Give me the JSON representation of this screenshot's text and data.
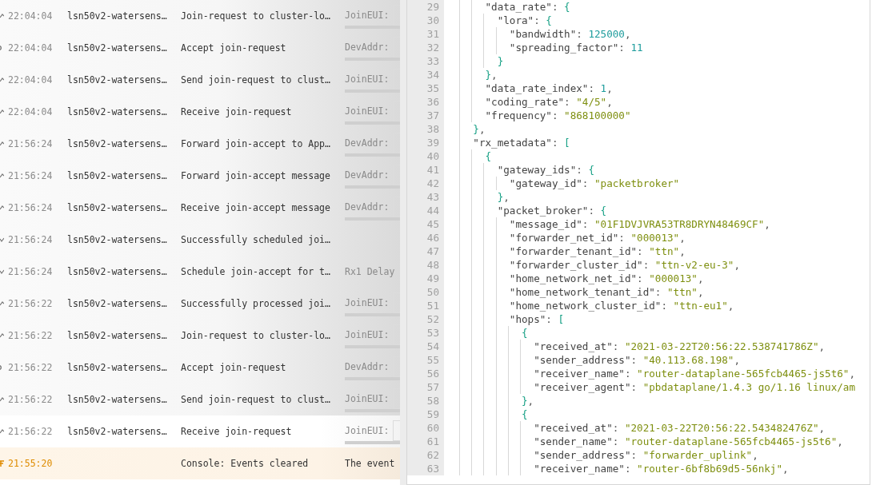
{
  "events": [
    {
      "kind": "up",
      "time": "22:04:04",
      "device": "lsn50v2-watersens…",
      "message": "Join-request to cluster-lo…",
      "preview": {
        "label": "JoinEUI:",
        "kind": "chip"
      },
      "selected": false
    },
    {
      "kind": "accept",
      "time": "22:04:04",
      "device": "lsn50v2-watersens…",
      "message": "Accept join-request",
      "preview": {
        "label": "DevAddr:",
        "kind": "chip"
      },
      "selected": false
    },
    {
      "kind": "up",
      "time": "22:04:04",
      "device": "lsn50v2-watersens…",
      "message": "Send join-request to clust…",
      "preview": {
        "label": "JoinEUI:",
        "kind": "chip"
      },
      "selected": false
    },
    {
      "kind": "up",
      "time": "22:04:04",
      "device": "lsn50v2-watersens…",
      "message": "Receive join-request",
      "preview": {
        "label": "JoinEUI:",
        "kind": "chip"
      },
      "selected": false
    },
    {
      "kind": "up",
      "time": "21:56:24",
      "device": "lsn50v2-watersens…",
      "message": "Forward join-accept to App…",
      "preview": {
        "label": "DevAddr:",
        "kind": "chip"
      },
      "selected": false
    },
    {
      "kind": "up",
      "time": "21:56:24",
      "device": "lsn50v2-watersens…",
      "message": "Forward join-accept message",
      "preview": {
        "label": "DevAddr:",
        "kind": "chip"
      },
      "selected": false
    },
    {
      "kind": "up",
      "time": "21:56:24",
      "device": "lsn50v2-watersens…",
      "message": "Receive join-accept message",
      "preview": {
        "label": "DevAddr:",
        "kind": "chip"
      },
      "selected": false
    },
    {
      "kind": "down",
      "time": "21:56:24",
      "device": "lsn50v2-watersens…",
      "message": "Successfully scheduled joi…",
      "selected": false
    },
    {
      "kind": "down",
      "time": "21:56:24",
      "device": "lsn50v2-watersens…",
      "message": "Schedule join-accept for t…",
      "preview": {
        "label": "Rx1 Delay",
        "kind": "text"
      },
      "selected": false
    },
    {
      "kind": "up",
      "time": "21:56:22",
      "device": "lsn50v2-watersens…",
      "message": "Successfully processed joi…",
      "preview": {
        "label": "JoinEUI:",
        "kind": "chip"
      },
      "selected": false
    },
    {
      "kind": "up",
      "time": "21:56:22",
      "device": "lsn50v2-watersens…",
      "message": "Join-request to cluster-lo…",
      "preview": {
        "label": "JoinEUI:",
        "kind": "chip"
      },
      "selected": false
    },
    {
      "kind": "accept",
      "time": "21:56:22",
      "device": "lsn50v2-watersens…",
      "message": "Accept join-request",
      "preview": {
        "label": "DevAddr:",
        "kind": "chip"
      },
      "selected": false
    },
    {
      "kind": "up",
      "time": "21:56:22",
      "device": "lsn50v2-watersens…",
      "message": "Send join-request to clust…",
      "preview": {
        "label": "JoinEUI:",
        "kind": "chip"
      },
      "selected": false
    },
    {
      "kind": "up",
      "time": "21:56:22",
      "device": "lsn50v2-watersens…",
      "message": "Receive join-request",
      "preview": {
        "label": "JoinEUI:",
        "kind": "chip"
      },
      "selected": true
    },
    {
      "kind": "console",
      "time": "21:55:20",
      "message": "Console: Events cleared",
      "preview": {
        "label": "The event",
        "kind": "text"
      },
      "selected": false
    }
  ],
  "code_lines": [
    {
      "n": "29",
      "t": [
        {
          "text": "      \"data_rate\"",
          "kind": "key"
        },
        {
          "text": ": ",
          "kind": "punct"
        },
        {
          "text": "{",
          "kind": "bracket"
        }
      ]
    },
    {
      "n": "30",
      "t": [
        {
          "text": "        \"lora\"",
          "kind": "key"
        },
        {
          "text": ": ",
          "kind": "punct"
        },
        {
          "text": "{",
          "kind": "bracket"
        }
      ]
    },
    {
      "n": "31",
      "t": [
        {
          "text": "          \"bandwidth\"",
          "kind": "key"
        },
        {
          "text": ": ",
          "kind": "punct"
        },
        {
          "text": "125000",
          "kind": "number"
        },
        {
          "text": ",",
          "kind": "punct"
        }
      ]
    },
    {
      "n": "32",
      "t": [
        {
          "text": "          \"spreading_factor\"",
          "kind": "key"
        },
        {
          "text": ": ",
          "kind": "punct"
        },
        {
          "text": "11",
          "kind": "number"
        }
      ]
    },
    {
      "n": "33",
      "t": [
        {
          "text": "        }",
          "kind": "bracket"
        }
      ]
    },
    {
      "n": "34",
      "t": [
        {
          "text": "      }",
          "kind": "bracket"
        },
        {
          "text": ",",
          "kind": "punct"
        }
      ]
    },
    {
      "n": "35",
      "t": [
        {
          "text": "      \"data_rate_index\"",
          "kind": "key"
        },
        {
          "text": ": ",
          "kind": "punct"
        },
        {
          "text": "1",
          "kind": "number"
        },
        {
          "text": ",",
          "kind": "punct"
        }
      ]
    },
    {
      "n": "36",
      "t": [
        {
          "text": "      \"coding_rate\"",
          "kind": "key"
        },
        {
          "text": ": ",
          "kind": "punct"
        },
        {
          "text": "\"4/5\"",
          "kind": "string"
        },
        {
          "text": ",",
          "kind": "punct"
        }
      ]
    },
    {
      "n": "37",
      "t": [
        {
          "text": "      \"frequency\"",
          "kind": "key"
        },
        {
          "text": ": ",
          "kind": "punct"
        },
        {
          "text": "\"868100000\"",
          "kind": "string"
        }
      ]
    },
    {
      "n": "38",
      "t": [
        {
          "text": "    }",
          "kind": "bracket"
        },
        {
          "text": ",",
          "kind": "punct"
        }
      ]
    },
    {
      "n": "39",
      "t": [
        {
          "text": "    \"rx_metadata\"",
          "kind": "key"
        },
        {
          "text": ": ",
          "kind": "punct"
        },
        {
          "text": "[",
          "kind": "bracket"
        }
      ]
    },
    {
      "n": "40",
      "t": [
        {
          "text": "      {",
          "kind": "bracket"
        }
      ]
    },
    {
      "n": "41",
      "t": [
        {
          "text": "        \"gateway_ids\"",
          "kind": "key"
        },
        {
          "text": ": ",
          "kind": "punct"
        },
        {
          "text": "{",
          "kind": "bracket"
        }
      ]
    },
    {
      "n": "42",
      "t": [
        {
          "text": "          \"gateway_id\"",
          "kind": "key"
        },
        {
          "text": ": ",
          "kind": "punct"
        },
        {
          "text": "\"packetbroker\"",
          "kind": "string"
        }
      ]
    },
    {
      "n": "43",
      "t": [
        {
          "text": "        }",
          "kind": "bracket"
        },
        {
          "text": ",",
          "kind": "punct"
        }
      ]
    },
    {
      "n": "44",
      "t": [
        {
          "text": "        \"packet_broker\"",
          "kind": "key"
        },
        {
          "text": ": ",
          "kind": "punct"
        },
        {
          "text": "{",
          "kind": "bracket"
        }
      ]
    },
    {
      "n": "45",
      "t": [
        {
          "text": "          \"message_id\"",
          "kind": "key"
        },
        {
          "text": ": ",
          "kind": "punct"
        },
        {
          "text": "\"01F1DVJVRA53TR8DRYN48469CF\"",
          "kind": "string"
        },
        {
          "text": ",",
          "kind": "punct"
        }
      ]
    },
    {
      "n": "46",
      "t": [
        {
          "text": "          \"forwarder_net_id\"",
          "kind": "key"
        },
        {
          "text": ": ",
          "kind": "punct"
        },
        {
          "text": "\"000013\"",
          "kind": "string"
        },
        {
          "text": ",",
          "kind": "punct"
        }
      ]
    },
    {
      "n": "47",
      "t": [
        {
          "text": "          \"forwarder_tenant_id\"",
          "kind": "key"
        },
        {
          "text": ": ",
          "kind": "punct"
        },
        {
          "text": "\"ttn\"",
          "kind": "string"
        },
        {
          "text": ",",
          "kind": "punct"
        }
      ]
    },
    {
      "n": "48",
      "t": [
        {
          "text": "          \"forwarder_cluster_id\"",
          "kind": "key"
        },
        {
          "text": ": ",
          "kind": "punct"
        },
        {
          "text": "\"ttn-v2-eu-3\"",
          "kind": "string"
        },
        {
          "text": ",",
          "kind": "punct"
        }
      ]
    },
    {
      "n": "49",
      "t": [
        {
          "text": "          \"home_network_net_id\"",
          "kind": "key"
        },
        {
          "text": ": ",
          "kind": "punct"
        },
        {
          "text": "\"000013\"",
          "kind": "string"
        },
        {
          "text": ",",
          "kind": "punct"
        }
      ]
    },
    {
      "n": "50",
      "t": [
        {
          "text": "          \"home_network_tenant_id\"",
          "kind": "key"
        },
        {
          "text": ": ",
          "kind": "punct"
        },
        {
          "text": "\"ttn\"",
          "kind": "string"
        },
        {
          "text": ",",
          "kind": "punct"
        }
      ]
    },
    {
      "n": "51",
      "t": [
        {
          "text": "          \"home_network_cluster_id\"",
          "kind": "key"
        },
        {
          "text": ": ",
          "kind": "punct"
        },
        {
          "text": "\"ttn-eu1\"",
          "kind": "string"
        },
        {
          "text": ",",
          "kind": "punct"
        }
      ]
    },
    {
      "n": "52",
      "t": [
        {
          "text": "          \"hops\"",
          "kind": "key"
        },
        {
          "text": ": ",
          "kind": "punct"
        },
        {
          "text": "[",
          "kind": "bracket"
        }
      ]
    },
    {
      "n": "53",
      "t": [
        {
          "text": "            {",
          "kind": "bracket"
        }
      ]
    },
    {
      "n": "54",
      "t": [
        {
          "text": "              \"received_at\"",
          "kind": "key"
        },
        {
          "text": ": ",
          "kind": "punct"
        },
        {
          "text": "\"2021-03-22T20:56:22.538741786Z\"",
          "kind": "string"
        },
        {
          "text": ",",
          "kind": "punct"
        }
      ]
    },
    {
      "n": "55",
      "t": [
        {
          "text": "              \"sender_address\"",
          "kind": "key"
        },
        {
          "text": ": ",
          "kind": "punct"
        },
        {
          "text": "\"40.113.68.198\"",
          "kind": "string"
        },
        {
          "text": ",",
          "kind": "punct"
        }
      ]
    },
    {
      "n": "56",
      "t": [
        {
          "text": "              \"receiver_name\"",
          "kind": "key"
        },
        {
          "text": ": ",
          "kind": "punct"
        },
        {
          "text": "\"router-dataplane-565fcb4465-js5t6\"",
          "kind": "string"
        },
        {
          "text": ",",
          "kind": "punct"
        }
      ]
    },
    {
      "n": "57",
      "t": [
        {
          "text": "              \"receiver_agent\"",
          "kind": "key"
        },
        {
          "text": ": ",
          "kind": "punct"
        },
        {
          "text": "\"pbdataplane/1.4.3 go/1.16 linux/am",
          "kind": "string"
        }
      ]
    },
    {
      "n": "58",
      "t": [
        {
          "text": "            }",
          "kind": "bracket"
        },
        {
          "text": ",",
          "kind": "punct"
        }
      ]
    },
    {
      "n": "59",
      "t": [
        {
          "text": "            {",
          "kind": "bracket"
        }
      ]
    },
    {
      "n": "60",
      "t": [
        {
          "text": "              \"received_at\"",
          "kind": "key"
        },
        {
          "text": ": ",
          "kind": "punct"
        },
        {
          "text": "\"2021-03-22T20:56:22.543482476Z\"",
          "kind": "string"
        },
        {
          "text": ",",
          "kind": "punct"
        }
      ]
    },
    {
      "n": "61",
      "t": [
        {
          "text": "              \"sender_name\"",
          "kind": "key"
        },
        {
          "text": ": ",
          "kind": "punct"
        },
        {
          "text": "\"router-dataplane-565fcb4465-js5t6\"",
          "kind": "string"
        },
        {
          "text": ",",
          "kind": "punct"
        }
      ]
    },
    {
      "n": "62",
      "t": [
        {
          "text": "              \"sender_address\"",
          "kind": "key"
        },
        {
          "text": ": ",
          "kind": "punct"
        },
        {
          "text": "\"forwarder_uplink\"",
          "kind": "string"
        },
        {
          "text": ",",
          "kind": "punct"
        }
      ]
    },
    {
      "n": "63",
      "t": [
        {
          "text": "              \"receiver_name\"",
          "kind": "key"
        },
        {
          "text": ": ",
          "kind": "punct"
        },
        {
          "text": "\"router-6bf8b69d5-56nkj\"",
          "kind": "string"
        },
        {
          "text": ",",
          "kind": "punct"
        }
      ]
    }
  ]
}
